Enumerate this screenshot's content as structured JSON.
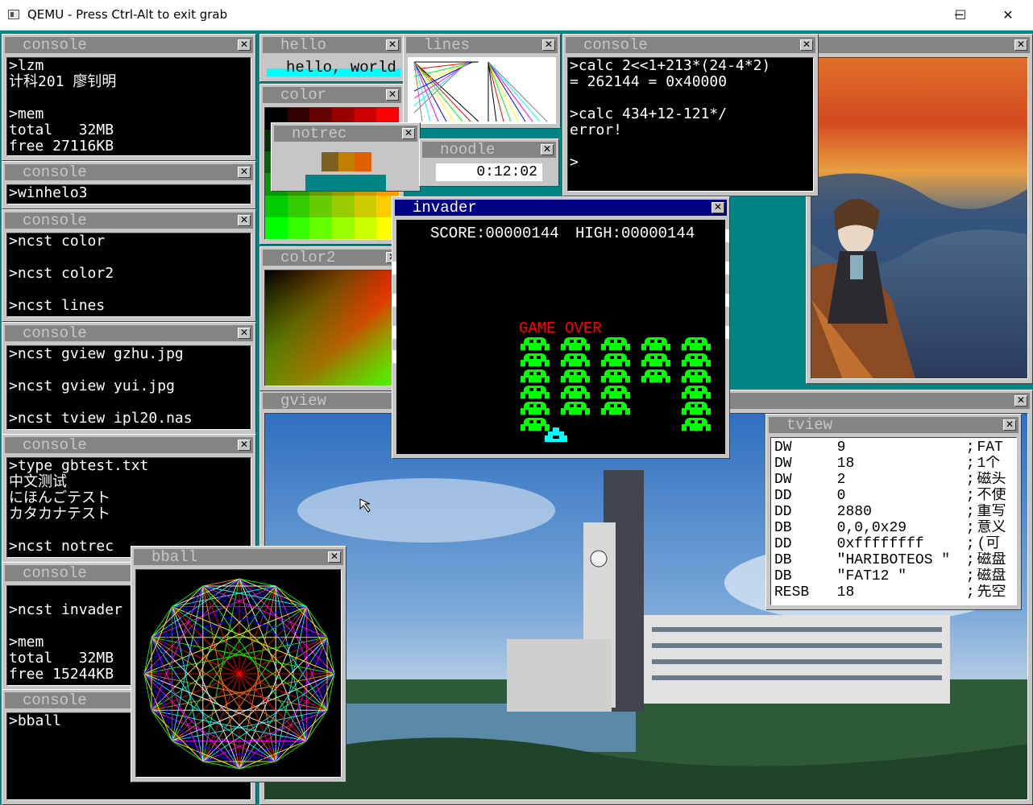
{
  "host": {
    "title": "QEMU - Press Ctrl-Alt to exit grab",
    "minimize": "─",
    "maximize": "☐",
    "close": "✕"
  },
  "windows": {
    "console1": {
      "title": "console",
      "lines": [
        ">lzm",
        "计科201 廖钊明",
        "",
        ">mem",
        "total   32MB",
        "free 27116KB"
      ]
    },
    "console2": {
      "title": "console",
      "lines": [
        ">winhelo3"
      ]
    },
    "console3": {
      "title": "console",
      "lines": [
        ">ncst color",
        "",
        ">ncst color2",
        "",
        ">ncst lines"
      ]
    },
    "console4": {
      "title": "console",
      "lines": [
        ">ncst gview gzhu.jpg",
        "",
        ">ncst gview yui.jpg",
        "",
        ">ncst tview ipl20.nas"
      ]
    },
    "console5": {
      "title": "console",
      "lines": [
        ">type gbtest.txt",
        "中文测试",
        "にほんごテスト",
        "カタカナテスト",
        "",
        ">ncst notrec"
      ]
    },
    "console6": {
      "title": "console",
      "lines": [
        "",
        ">ncst invader",
        "",
        ">mem",
        "total   32MB",
        "free 15244KB"
      ]
    },
    "console7": {
      "title": "console",
      "lines": [
        ">bball"
      ]
    },
    "console_calc": {
      "title": "console",
      "lines": [
        ">calc 2<<1+213*(24-4*2)",
        "= 262144 = 0x40000",
        "",
        ">calc 434+12-121*/",
        "error!",
        "",
        ">"
      ]
    },
    "hello": {
      "title": "hello",
      "text": "hello, world"
    },
    "lines": {
      "title": "lines"
    },
    "color": {
      "title": "color"
    },
    "color2": {
      "title": "color2"
    },
    "notrec": {
      "title": "notrec"
    },
    "noodle": {
      "title": "noodle",
      "time": "0:12:02"
    },
    "gview": {
      "title": "gview"
    },
    "bball": {
      "title": "bball"
    },
    "invader": {
      "title": "invader",
      "score": "SCORE:00000144",
      "high": "HIGH:00000144",
      "game_over": "GAME OVER",
      "alien_columns": [
        6,
        5,
        5,
        3,
        6
      ]
    },
    "tview": {
      "title": "tview",
      "rows": [
        {
          "op": "DW",
          "arg": "9",
          "comment": "FAT"
        },
        {
          "op": "DW",
          "arg": "18",
          "comment": "1个"
        },
        {
          "op": "DW",
          "arg": "2",
          "comment": "磁头"
        },
        {
          "op": "DD",
          "arg": "0",
          "comment": "不使"
        },
        {
          "op": "DD",
          "arg": "2880",
          "comment": "重写"
        },
        {
          "op": "DB",
          "arg": "0,0,0x29",
          "comment": "意义"
        },
        {
          "op": "DD",
          "arg": "0xffffffff",
          "comment": "(可"
        },
        {
          "op": "DB",
          "arg": "\"HARIBOTEOS \"",
          "comment": "磁盘"
        },
        {
          "op": "DB",
          "arg": "\"FAT12   \"",
          "comment": "磁盘"
        },
        {
          "op": "RESB",
          "arg": "18",
          "comment": "先空"
        }
      ]
    }
  },
  "colors": {
    "desktop": "#008484",
    "window": "#c6c6c6",
    "active_title": "#000084",
    "inactive_title": "#848484",
    "alien": "#00ff00",
    "game_over": "#ff0000",
    "hello_bar": "#00ffff"
  }
}
